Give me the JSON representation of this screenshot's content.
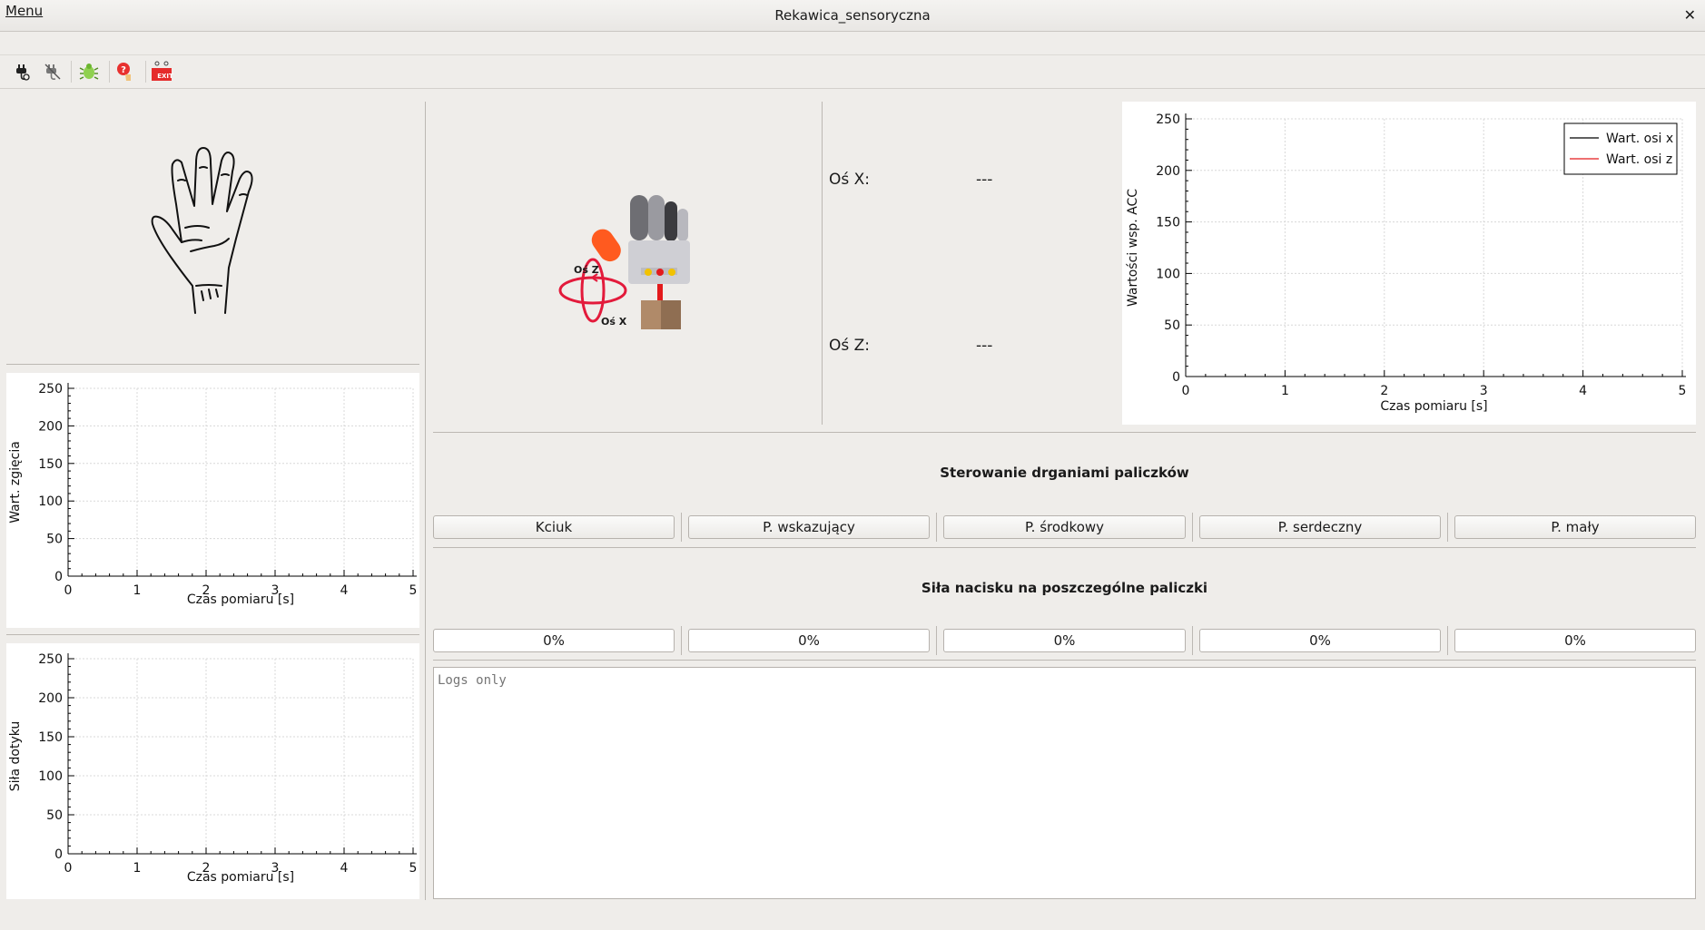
{
  "window": {
    "title": "Rekawica_sensoryczna",
    "close_glyph": "✕"
  },
  "menubar": {
    "menu_label": "Menu"
  },
  "toolbar": {
    "icons": [
      "connect-plug-icon",
      "disconnect-plug-icon",
      "bug-icon",
      "help-icon",
      "exit-icon"
    ],
    "exit_text": "EXIT"
  },
  "orientation": {
    "axis_x_label": "Oś X:",
    "axis_x_value": "---",
    "axis_z_label": "Oś Z:",
    "axis_z_value": "---",
    "illustration_label_z": "Oś Z",
    "illustration_label_x": "Oś X"
  },
  "vibration": {
    "title": "Sterowanie drganiami paliczków",
    "buttons": [
      "Kciuk",
      "P. wskazujący",
      "P. środkowy",
      "P. serdeczny",
      "P. mały"
    ]
  },
  "pressure": {
    "title": "Siła nacisku na poszczególne paliczki",
    "values": [
      "0%",
      "0%",
      "0%",
      "0%",
      "0%"
    ]
  },
  "log": {
    "placeholder": "Logs only"
  },
  "colors": {
    "series_x": "#000000",
    "series_z": "#e31a1c",
    "grid": "#d8d8d8",
    "accent_orange": "#ff5a1f"
  },
  "chart_data": [
    {
      "id": "bend",
      "type": "line",
      "title": "",
      "xlabel": "Czas pomiaru [s]",
      "ylabel": "Wart. zgięcia",
      "xlim": [
        0,
        5
      ],
      "ylim": [
        0,
        250
      ],
      "xticks": [
        0,
        1,
        2,
        3,
        4,
        5
      ],
      "yticks": [
        0,
        50,
        100,
        150,
        200,
        250
      ],
      "grid": true,
      "series": []
    },
    {
      "id": "touch",
      "type": "line",
      "title": "",
      "xlabel": "Czas pomiaru [s]",
      "ylabel": "Siła dotyku",
      "xlim": [
        0,
        5
      ],
      "ylim": [
        0,
        250
      ],
      "xticks": [
        0,
        1,
        2,
        3,
        4,
        5
      ],
      "yticks": [
        0,
        50,
        100,
        150,
        200,
        250
      ],
      "grid": true,
      "series": []
    },
    {
      "id": "acc",
      "type": "line",
      "title": "",
      "xlabel": "Czas pomiaru [s]",
      "ylabel": "Wartości wsp. ACC",
      "xlim": [
        0,
        5
      ],
      "ylim": [
        0,
        250
      ],
      "xticks": [
        0,
        1,
        2,
        3,
        4,
        5
      ],
      "yticks": [
        0,
        50,
        100,
        150,
        200,
        250
      ],
      "grid": true,
      "legend": "top-right",
      "series": [
        {
          "name": "Wart. osi x",
          "color": "#000000",
          "values": []
        },
        {
          "name": "Wart. osi z",
          "color": "#e31a1c",
          "values": []
        }
      ]
    }
  ]
}
